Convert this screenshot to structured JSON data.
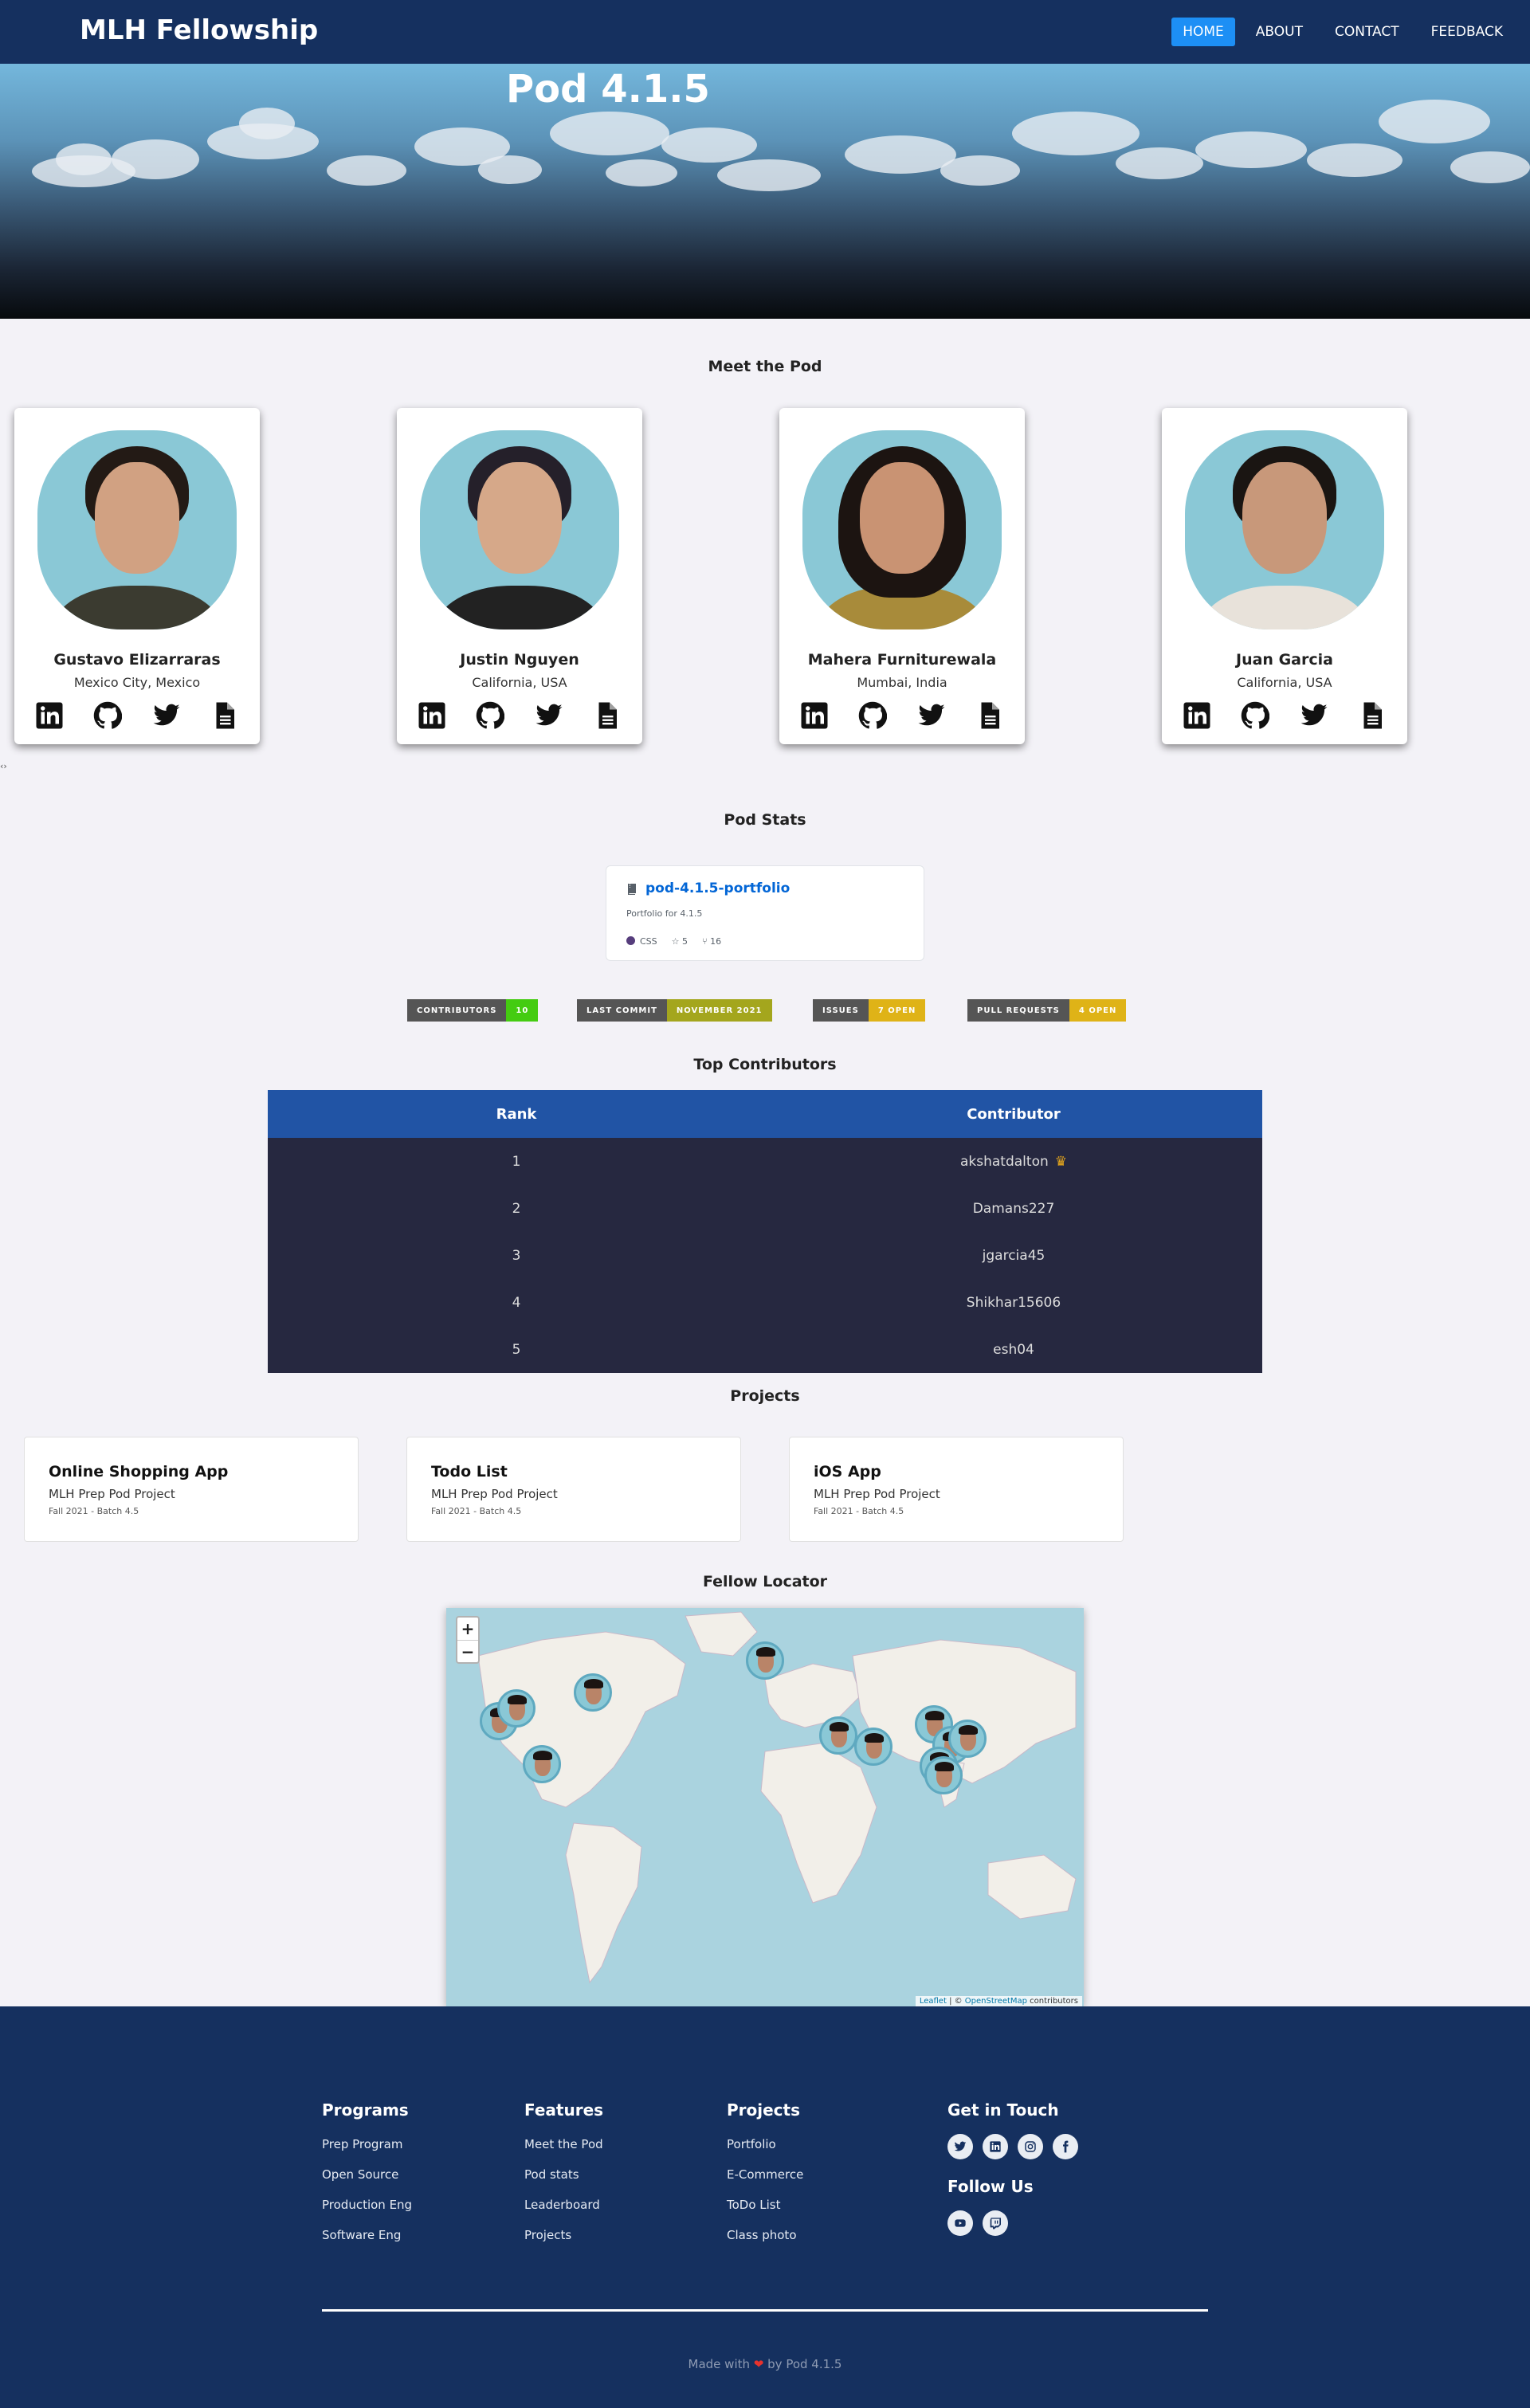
{
  "nav": {
    "brand": "MLH Fellowship",
    "links": [
      {
        "label": "HOME",
        "active": true
      },
      {
        "label": "ABOUT",
        "active": false
      },
      {
        "label": "CONTACT",
        "active": false
      },
      {
        "label": "FEEDBACK",
        "active": false
      }
    ]
  },
  "hero": {
    "title": "Pod 4.1.5"
  },
  "meet": {
    "title": "Meet the Pod",
    "members": [
      {
        "name": "Gustavo Elizarraras",
        "location": "Mexico City, Mexico"
      },
      {
        "name": "Justin Nguyen",
        "location": "California, USA"
      },
      {
        "name": "Mahera Furniturewala",
        "location": "Mumbai, India"
      },
      {
        "name": "Juan Garcia",
        "location": "California, USA"
      }
    ],
    "icons": [
      "linkedin-icon",
      "github-icon",
      "twitter-icon",
      "document-icon"
    ]
  },
  "tiny_mark": "‹›",
  "stats": {
    "title": "Pod Stats",
    "repo": {
      "name": "pod-4.1.5-portfolio",
      "description": "Portfolio for 4.1.5",
      "language": "CSS",
      "stars": "5",
      "forks": "16",
      "language_color": "#563d7c"
    },
    "badges": [
      {
        "label": "CONTRIBUTORS",
        "value": "10",
        "color": "#4c1"
      },
      {
        "label": "LAST COMMIT",
        "value": "NOVEMBER 2021",
        "color": "#a4a61d"
      },
      {
        "label": "ISSUES",
        "value": "7 OPEN",
        "color": "#dfb317"
      },
      {
        "label": "PULL REQUESTS",
        "value": "4 OPEN",
        "color": "#dfb317"
      }
    ]
  },
  "contributors": {
    "title": "Top Contributors",
    "headers": [
      "Rank",
      "Contributor"
    ],
    "rows": [
      {
        "rank": "1",
        "name": "akshatdalton",
        "crown": "♛"
      },
      {
        "rank": "2",
        "name": "Damans227"
      },
      {
        "rank": "3",
        "name": "jgarcia45"
      },
      {
        "rank": "4",
        "name": "Shikhar15606"
      },
      {
        "rank": "5",
        "name": "esh04"
      }
    ]
  },
  "projects": {
    "title": "Projects",
    "items": [
      {
        "title": "Online Shopping App",
        "subtitle": "MLH Prep Pod Project",
        "meta": "Fall 2021 - Batch 4.5"
      },
      {
        "title": "Todo List",
        "subtitle": "MLH Prep Pod Project",
        "meta": "Fall 2021 - Batch 4.5"
      },
      {
        "title": "iOS App",
        "subtitle": "MLH Prep Pod Project",
        "meta": "Fall 2021 - Batch 4.5"
      }
    ]
  },
  "map": {
    "title": "Fellow Locator",
    "zoom_in": "+",
    "zoom_out": "−",
    "attribution_leaflet": "Leaflet",
    "attribution_sep": " | © ",
    "attribution_osm": "OpenStreetMap",
    "attribution_tail": " contributors"
  },
  "footer": {
    "columns": [
      {
        "title": "Programs",
        "links": [
          "Prep Program",
          "Open Source",
          "Production Eng",
          "Software Eng"
        ]
      },
      {
        "title": "Features",
        "links": [
          "Meet the Pod",
          "Pod stats",
          "Leaderboard",
          "Projects"
        ]
      },
      {
        "title": "Projects",
        "links": [
          "Portfolio",
          "E-Commerce",
          "ToDo List",
          "Class photo"
        ]
      }
    ],
    "get_in_touch": "Get in Touch",
    "follow_us": "Follow Us",
    "made_with": "Made with",
    "heart": "❤",
    "by": "by Pod 4.1.5"
  }
}
